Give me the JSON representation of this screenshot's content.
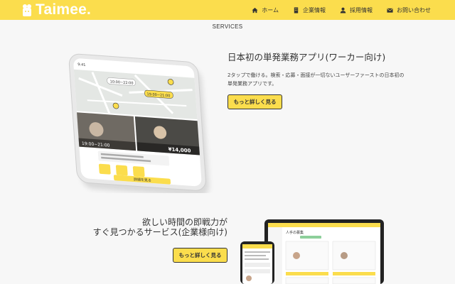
{
  "header": {
    "logo_text": "Taimee.",
    "nav": [
      {
        "label": "ホーム",
        "icon": "home-icon"
      },
      {
        "label": "企業情報",
        "icon": "building-icon"
      },
      {
        "label": "採用情報",
        "icon": "person-icon"
      },
      {
        "label": "お問い合わせ",
        "icon": "mail-icon"
      }
    ]
  },
  "services": {
    "section_title": "SERVICES",
    "worker": {
      "title": "日本初の単発業務アプリ(ワーカー向け)",
      "description": "2タップで働ける。検索・応募・面接が一切ないユーザーファーストの日本初の単発業務アプリです。",
      "button_label": "もっと詳しく見る"
    },
    "company": {
      "title_line1": "欲しい時間の即戦力が",
      "title_line2": "すぐ見つかるサービス(企業様向け)",
      "button_label": "もっと詳しく見る"
    }
  },
  "phone_screen": {
    "time": "9:41",
    "price": "¥14,000",
    "slot1": "10:00~22:00",
    "slot2": "19:00~21:00",
    "cta": "詳細を見る"
  },
  "laptop_screen": {
    "heading": "人手の募集"
  },
  "colors": {
    "brand_yellow": "#fbdd4d",
    "text_dark": "#333333",
    "background": "#f7f7f7"
  }
}
